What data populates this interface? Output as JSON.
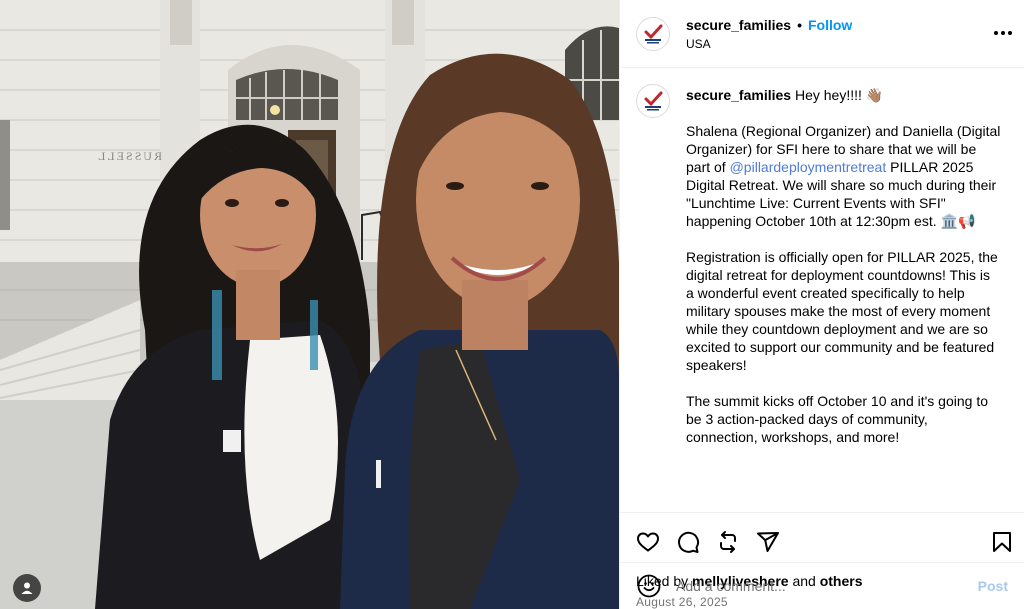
{
  "post": {
    "username": "secure_families",
    "follow_label": "Follow",
    "separator": "•",
    "location": "USA",
    "more_icon": "more-horizontal-icon",
    "photo_alt": "Two women smiling in front of the Russell Senate Office Building",
    "building_sign": "RUSSELL"
  },
  "caption": {
    "username": "secure_families",
    "first_line": "Hey hey!!!! 👋🏽",
    "p1_a": "Shalena (Regional Organizer) and Daniella (Digital Organizer) for SFI here to share that we will be part of ",
    "p1_mention": "@pillardeploymentretreat",
    "p1_b": " PILLAR 2025 Digital Retreat. We will share so much during their \"Lunchtime Live: Current Events with SFI\" happening October 10th at 12:30pm est. 🏛️📢",
    "p2": "Registration is officially open for PILLAR 2025, the digital retreat for deployment countdowns! This is a wonderful event created specifically to help military spouses make the most of every moment while they countdown deployment and we are so excited to support our community and be featured speakers!",
    "p3": "The summit kicks off October 10 and it's going to be 3 action-packed days of community, connection, workshops, and more!"
  },
  "actions": {
    "icons": [
      "heart-icon",
      "comment-icon",
      "repost-icon",
      "share-icon",
      "bookmark-icon"
    ]
  },
  "likes": {
    "prefix": "Liked by ",
    "user": "mellyliveshere",
    "and": " and ",
    "others": "others"
  },
  "date": "August 26, 2025",
  "comment": {
    "placeholder": "Add a comment...",
    "post_label": "Post",
    "emoji_icon": "emoji-icon"
  },
  "colors": {
    "link_blue": "#0095f6",
    "mention_blue": "#4f7bd9",
    "post_disabled": "#a8c8f4",
    "muted": "#737373",
    "divider": "#efefef"
  }
}
